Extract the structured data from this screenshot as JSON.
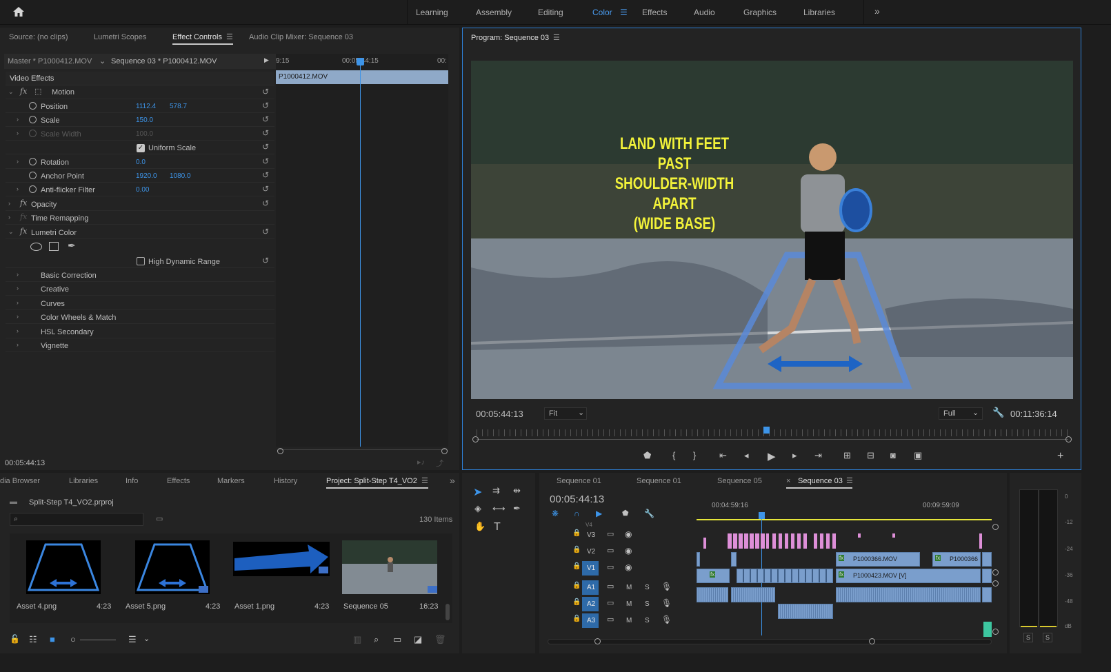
{
  "workspaces": [
    "Learning",
    "Assembly",
    "Editing",
    "Color",
    "Effects",
    "Audio",
    "Graphics",
    "Libraries"
  ],
  "active_workspace": "Color",
  "left_tabs": [
    "Source: (no clips)",
    "Lumetri Scopes",
    "Effect Controls",
    "Audio Clip Mixer: Sequence 03"
  ],
  "effect_controls": {
    "master": "Master * P1000412.MOV",
    "sequence": "Sequence 03 * P1000412.MOV",
    "timeline_labels": [
      "9:15",
      "00:05:44:15",
      "00:"
    ],
    "clip_name": "P1000412.MOV",
    "section": "Video Effects",
    "motion": "Motion",
    "position_label": "Position",
    "position_x": "1112.4",
    "position_y": "578.7",
    "scale_label": "Scale",
    "scale_val": "150.0",
    "scale_width_label": "Scale Width",
    "scale_width_val": "100.0",
    "uniform_label": "Uniform Scale",
    "rotation_label": "Rotation",
    "rotation_val": "0.0",
    "anchor_label": "Anchor Point",
    "anchor_x": "1920.0",
    "anchor_y": "1080.0",
    "antiflicker_label": "Anti-flicker Filter",
    "antiflicker_val": "0.00",
    "opacity": "Opacity",
    "time_remap": "Time Remapping",
    "lumetri": "Lumetri Color",
    "hdr_label": "High Dynamic Range",
    "lumetri_items": [
      "Basic Correction",
      "Creative",
      "Curves",
      "Color Wheels & Match",
      "HSL Secondary",
      "Vignette"
    ],
    "timecode": "00:05:44:13"
  },
  "program": {
    "title": "Program: Sequence 03",
    "overlay_text": [
      "LAND WITH FEET PAST",
      "SHOULDER-WIDTH APART",
      "(WIDE BASE)"
    ],
    "timecode": "00:05:44:13",
    "fit": "Fit",
    "full": "Full",
    "duration": "00:11:36:14"
  },
  "project_tabs": [
    "dia Browser",
    "Libraries",
    "Info",
    "Effects",
    "Markers",
    "History",
    "Project: Split-Step T4_VO2"
  ],
  "project": {
    "file": "Split-Step T4_VO2.prproj",
    "items_count": "130 Items",
    "assets": [
      {
        "name": "Asset 4.png",
        "dur": "4:23"
      },
      {
        "name": "Asset 5.png",
        "dur": "4:23"
      },
      {
        "name": "Asset 1.png",
        "dur": "4:23"
      },
      {
        "name": "Sequence 05",
        "dur": "16:23"
      }
    ]
  },
  "timeline": {
    "tabs": [
      "Sequence 01",
      "Sequence 01",
      "Sequence 05",
      "Sequence 03"
    ],
    "timecode": "00:05:44:13",
    "ruler": [
      "00:04:59:16",
      "00:09:59:09"
    ],
    "tracks_video": [
      "V3",
      "V2",
      "V1"
    ],
    "tracks_audio": [
      "A1",
      "A2",
      "A3"
    ],
    "v4": "V4",
    "clip_v2a": "P1000366.MOV",
    "clip_v2b": "P1000366",
    "clip_v1": "P1000423.MOV [V]"
  },
  "meter_scale": [
    "0",
    "-12",
    "-24",
    "-36",
    "-48",
    "dB"
  ],
  "meter_solo": [
    "S",
    "S"
  ]
}
